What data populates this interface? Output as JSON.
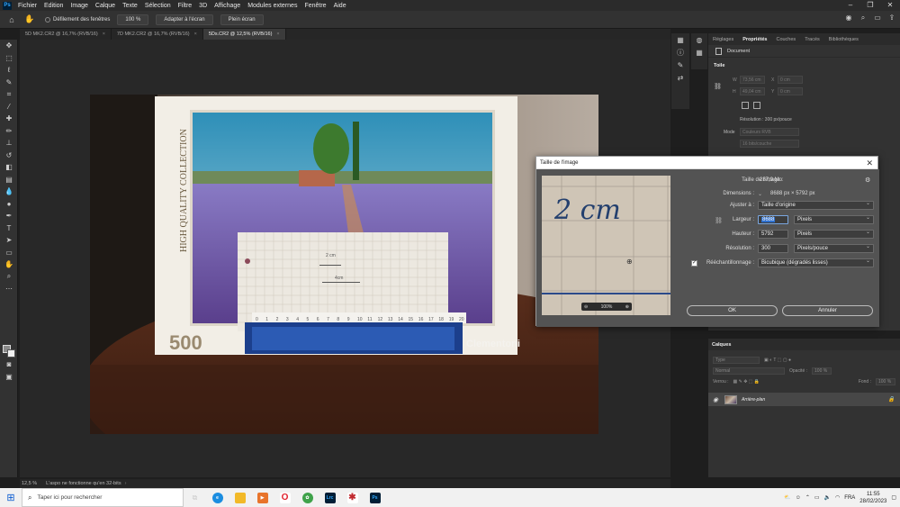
{
  "menubar": {
    "logo": "Ps",
    "items": [
      "Fichier",
      "Edition",
      "Image",
      "Calque",
      "Texte",
      "Sélection",
      "Filtre",
      "3D",
      "Affichage",
      "Modules externes",
      "Fenêtre",
      "Aide"
    ],
    "controls": [
      "–",
      "❐",
      "✕"
    ]
  },
  "options": {
    "scroll_all": "Défilement des fenêtres",
    "zoom_100": "100 %",
    "fit_screen": "Adapter à l'écran",
    "full_screen": "Plein écran"
  },
  "tabs": [
    {
      "label": "5D MK2.CR2 @ 16,7% (RVB/16)",
      "close": "×"
    },
    {
      "label": "7D MK2.CR2 @ 16,7% (RVB/16)",
      "close": "×"
    },
    {
      "label": "5Ds.CR2 @ 12,5% (RVB/16)",
      "close": "×"
    }
  ],
  "status": {
    "zoom": "12,5 %",
    "message": "L'aspo ne fonctionne qu'en 32-bits",
    "arrow": "›"
  },
  "properties": {
    "tabs": [
      "Réglages",
      "Propriétés",
      "Couches",
      "Tracés",
      "Bibliothèques"
    ],
    "document_label": "Document",
    "section": "Toile",
    "w_label": "W",
    "w_value": "73,56 cm",
    "x_label": "X",
    "x_value": "0 cm",
    "h_label": "H",
    "h_value": "49,04 cm",
    "y_label": "Y",
    "y_value": "0 cm",
    "resolution_text": "Résolution : 300 px/pouce",
    "mode_label": "Mode",
    "mode_value": "Couleurs RVB",
    "depth_value": "16 bits/couche"
  },
  "layers": {
    "title": "Calques",
    "filter_placeholder": "Type",
    "blend_mode": "Normal",
    "opacity_label": "Opacité :",
    "opacity_value": "100 %",
    "lock_label": "Verrou :",
    "fill_label": "Fond :",
    "fill_value": "100 %",
    "layer_name": "Arrière-plan"
  },
  "dialog": {
    "title": "Taille de l'image",
    "close": "✕",
    "preview_zoom": "100%",
    "preview_handwriting": "2 cm",
    "size_label": "Taille de l'image :",
    "size_value": "287,9 Mo",
    "dimensions_label": "Dimensions :",
    "dimensions_value": "8688 px  ×  5792 px",
    "fit_label": "Ajuster à :",
    "fit_value": "Taille d'origine",
    "width_label": "Largeur :",
    "width_value": "8688",
    "width_unit": "Pixels",
    "height_label": "Hauteur :",
    "height_value": "5792",
    "height_unit": "Pixels",
    "resolution_label": "Résolution :",
    "resolution_value": "300",
    "resolution_unit": "Pixels/pouce",
    "resample_label": "Rééchantillonnage :",
    "resample_value": "Bicubique (dégradés lisses)",
    "ok": "OK",
    "cancel": "Annuler"
  },
  "photo": {
    "puzzle_count": "500",
    "brand": "Clementoni",
    "collection": "HIGH QUALITY COLLECTION",
    "ruler_numbers": [
      "0",
      "1",
      "2",
      "3",
      "4",
      "5",
      "6",
      "7",
      "8",
      "9",
      "10",
      "11",
      "12",
      "13",
      "14",
      "15",
      "16",
      "17",
      "18",
      "19",
      "20"
    ],
    "card_text_1": "2 cm",
    "card_text_2": "4cm"
  },
  "taskbar": {
    "search_placeholder": "Taper ici pour rechercher",
    "lang": "FRA",
    "time": "11:55",
    "date": "28/02/2023"
  }
}
